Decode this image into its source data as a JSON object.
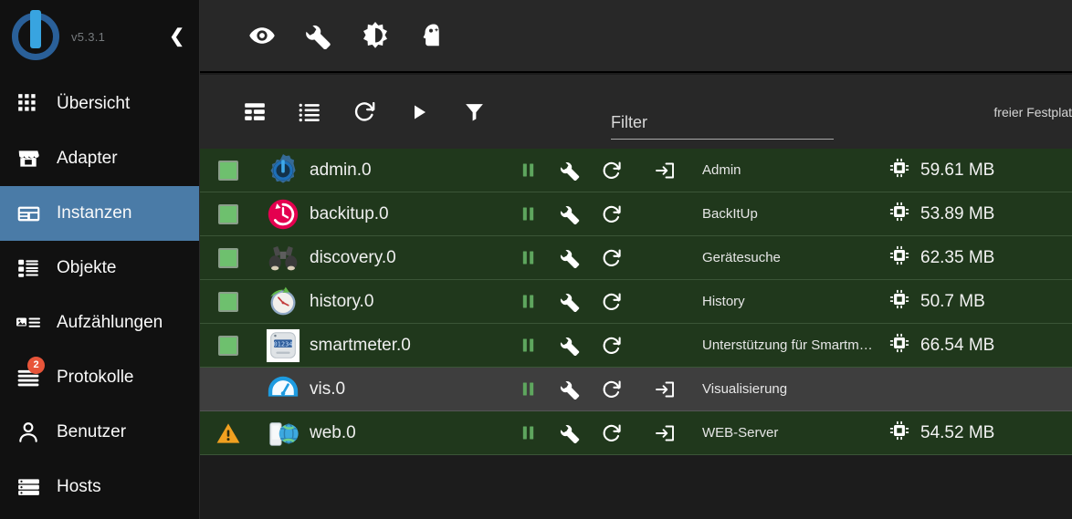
{
  "sidebar": {
    "logo_icon": "iobroker-logo",
    "version": "v5.3.1",
    "collapse_icon": "chevron-left-icon",
    "items": [
      {
        "label": "Übersicht",
        "icon": "grid-icon",
        "active": false,
        "badge": ""
      },
      {
        "label": "Adapter",
        "icon": "store-icon",
        "active": false,
        "badge": ""
      },
      {
        "label": "Instanzen",
        "icon": "instances-icon",
        "active": true,
        "badge": ""
      },
      {
        "label": "Objekte",
        "icon": "list-alt-icon",
        "active": false,
        "badge": ""
      },
      {
        "label": "Aufzählungen",
        "icon": "enum-icon",
        "active": false,
        "badge": ""
      },
      {
        "label": "Protokolle",
        "icon": "log-lines-icon",
        "active": false,
        "badge": "2"
      },
      {
        "label": "Benutzer",
        "icon": "person-icon",
        "active": false,
        "badge": ""
      },
      {
        "label": "Hosts",
        "icon": "server-rack-icon",
        "active": false,
        "badge": ""
      }
    ]
  },
  "header": {
    "icons": [
      {
        "name": "eye-icon",
        "title": "eye"
      },
      {
        "name": "wrench-icon",
        "title": "wrench"
      },
      {
        "name": "brightness-icon",
        "title": "brightness"
      },
      {
        "name": "head-icon",
        "title": "head"
      }
    ]
  },
  "toolbar": {
    "icons": [
      {
        "name": "table-view-icon",
        "title": "table view"
      },
      {
        "name": "list-view-icon",
        "title": "list view"
      },
      {
        "name": "refresh-icon",
        "title": "refresh"
      },
      {
        "name": "play-icon",
        "title": "start all"
      },
      {
        "name": "filter-icon",
        "title": "filter"
      }
    ],
    "filter_placeholder": "Filter",
    "filter_value": "",
    "disk_label": "freier Festplat"
  },
  "colors": {
    "accent": "#4a7ba7",
    "row_running": "#20381c",
    "row_inactive": "#3e3e3e",
    "status_green": "#6ec06e",
    "warning_orange": "#f0a020",
    "badge_red": "#e8553a",
    "header_bg": "#282828",
    "sidebar_bg": "#111111"
  },
  "table": {
    "rows": [
      {
        "status": "running",
        "adapter_icon": "admin-gear-icon",
        "name": "admin.0",
        "pause_icon": "pause-icon",
        "settings_icon": "wrench-icon",
        "restart_icon": "refresh-icon",
        "link_icon": "open-in-icon",
        "has_link": true,
        "description": "Admin",
        "mem_icon": "memory-chip-icon",
        "memory": "59.61 MB",
        "has_memory": true
      },
      {
        "status": "running",
        "adapter_icon": "backitup-clock-icon",
        "name": "backitup.0",
        "pause_icon": "pause-icon",
        "settings_icon": "wrench-icon",
        "restart_icon": "refresh-icon",
        "link_icon": "",
        "has_link": false,
        "description": "BackItUp",
        "mem_icon": "memory-chip-icon",
        "memory": "53.89 MB",
        "has_memory": true
      },
      {
        "status": "running",
        "adapter_icon": "binoculars-icon",
        "name": "discovery.0",
        "pause_icon": "pause-icon",
        "settings_icon": "wrench-icon",
        "restart_icon": "refresh-icon",
        "link_icon": "",
        "has_link": false,
        "description": "Gerätesuche",
        "mem_icon": "memory-chip-icon",
        "memory": "62.35 MB",
        "has_memory": true
      },
      {
        "status": "running",
        "adapter_icon": "history-clock-icon",
        "name": "history.0",
        "pause_icon": "pause-icon",
        "settings_icon": "wrench-icon",
        "restart_icon": "refresh-icon",
        "link_icon": "",
        "has_link": false,
        "description": "History",
        "mem_icon": "memory-chip-icon",
        "memory": "50.7 MB",
        "has_memory": true
      },
      {
        "status": "running",
        "adapter_icon": "smartmeter-icon",
        "name": "smartmeter.0",
        "pause_icon": "pause-icon",
        "settings_icon": "wrench-icon",
        "restart_icon": "refresh-icon",
        "link_icon": "",
        "has_link": false,
        "description": "Unterstützung für Smartm…",
        "mem_icon": "memory-chip-icon",
        "memory": "66.54 MB",
        "has_memory": true
      },
      {
        "status": "none",
        "adapter_icon": "vis-gauge-icon",
        "name": "vis.0",
        "pause_icon": "pause-icon",
        "settings_icon": "wrench-icon",
        "restart_icon": "refresh-icon",
        "link_icon": "open-in-icon",
        "has_link": true,
        "description": "Visualisierung",
        "mem_icon": "",
        "memory": "",
        "has_memory": false
      },
      {
        "status": "warning",
        "adapter_icon": "web-globe-icon",
        "name": "web.0",
        "pause_icon": "pause-icon",
        "settings_icon": "wrench-icon",
        "restart_icon": "refresh-icon",
        "link_icon": "open-in-icon",
        "has_link": true,
        "description": "WEB-Server",
        "mem_icon": "memory-chip-icon",
        "memory": "54.52 MB",
        "has_memory": true
      }
    ]
  }
}
